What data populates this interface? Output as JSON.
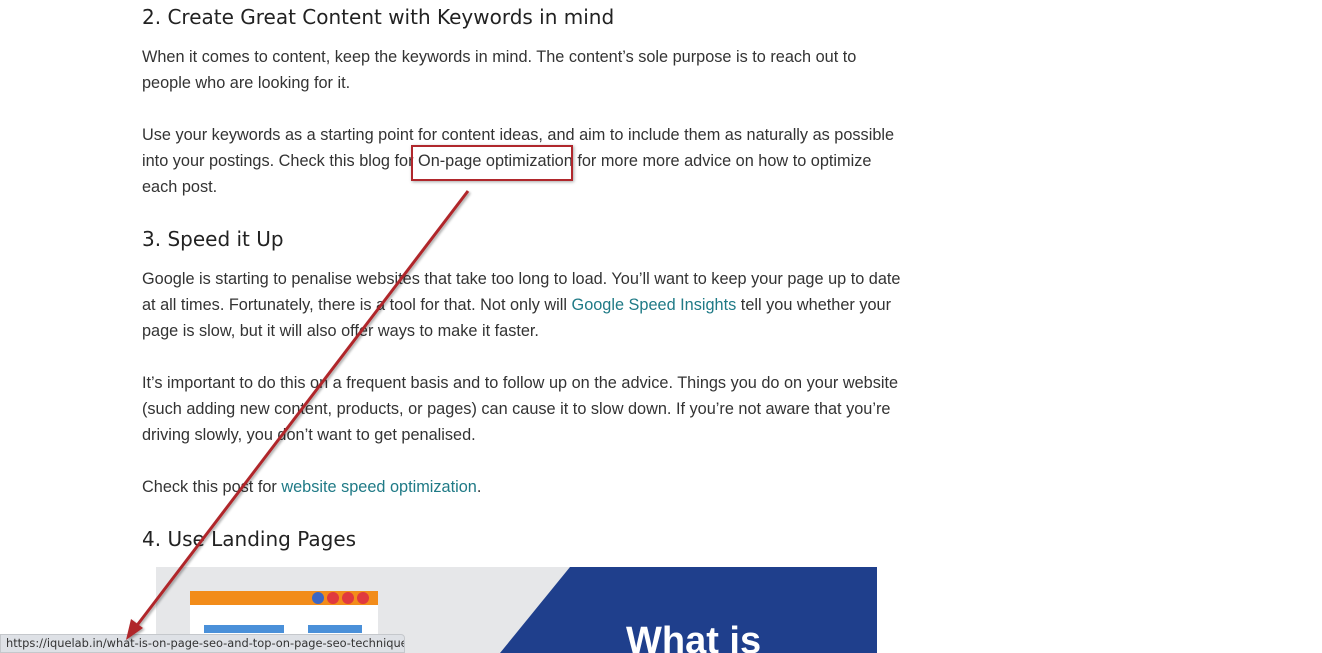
{
  "article": {
    "section2": {
      "heading": "2. Create Great Content with Keywords in mind",
      "p1_line1": "When it comes to content, keep the keywords in mind. The content’s sole purpose is to reach out to",
      "p1_line2": "people who are looking for it.",
      "p2_line1": "Use your keywords as a starting point for content ideas, and aim to include them as naturally as possible",
      "p2_line2_before": "into your postings. Check this blog for ",
      "p2_line2_link": "On-page optimization",
      "p2_line2_after": " for more more advice on how to optimize",
      "p2_line3": "each post."
    },
    "section3": {
      "heading": "3. Speed it Up",
      "p1_line1": "Google is starting to penalise websites that take too long to load. You’ll want to keep your page up to date",
      "p1_line2_before": "at all times. Fortunately, there is a tool for that. Not only will ",
      "p1_line2_link": "Google Speed Insights",
      "p1_line2_after": " tell you whether your",
      "p1_line3": "page is slow, but it will also offer ways to make it faster.",
      "p2_line1": "It’s important to do this on a frequent basis and to follow up on the advice. Things you do on your website",
      "p2_line2": "(such adding new content, products, or pages) can cause it to slow down. If you’re not aware that you’re",
      "p2_line3": "driving slowly, you don’t want to get penalised.",
      "p3_before": "Check this post for ",
      "p3_link": "website speed optimization",
      "p3_after": "."
    },
    "section4": {
      "heading": "4. Use Landing Pages",
      "banner_text": "What is"
    }
  },
  "status_bar": {
    "url": "https://iquelab.in/what-is-on-page-seo-and-top-on-page-seo-techniques/"
  },
  "colors": {
    "link": "#1f7a86",
    "annotation": "#b0272c",
    "banner_navy": "#1f3f8c",
    "banner_gray": "#e6e7e9",
    "banner_orange": "#f28c1a"
  },
  "icons": {
    "annotation_arrow": "arrow-icon",
    "highlight": "highlight-box"
  }
}
